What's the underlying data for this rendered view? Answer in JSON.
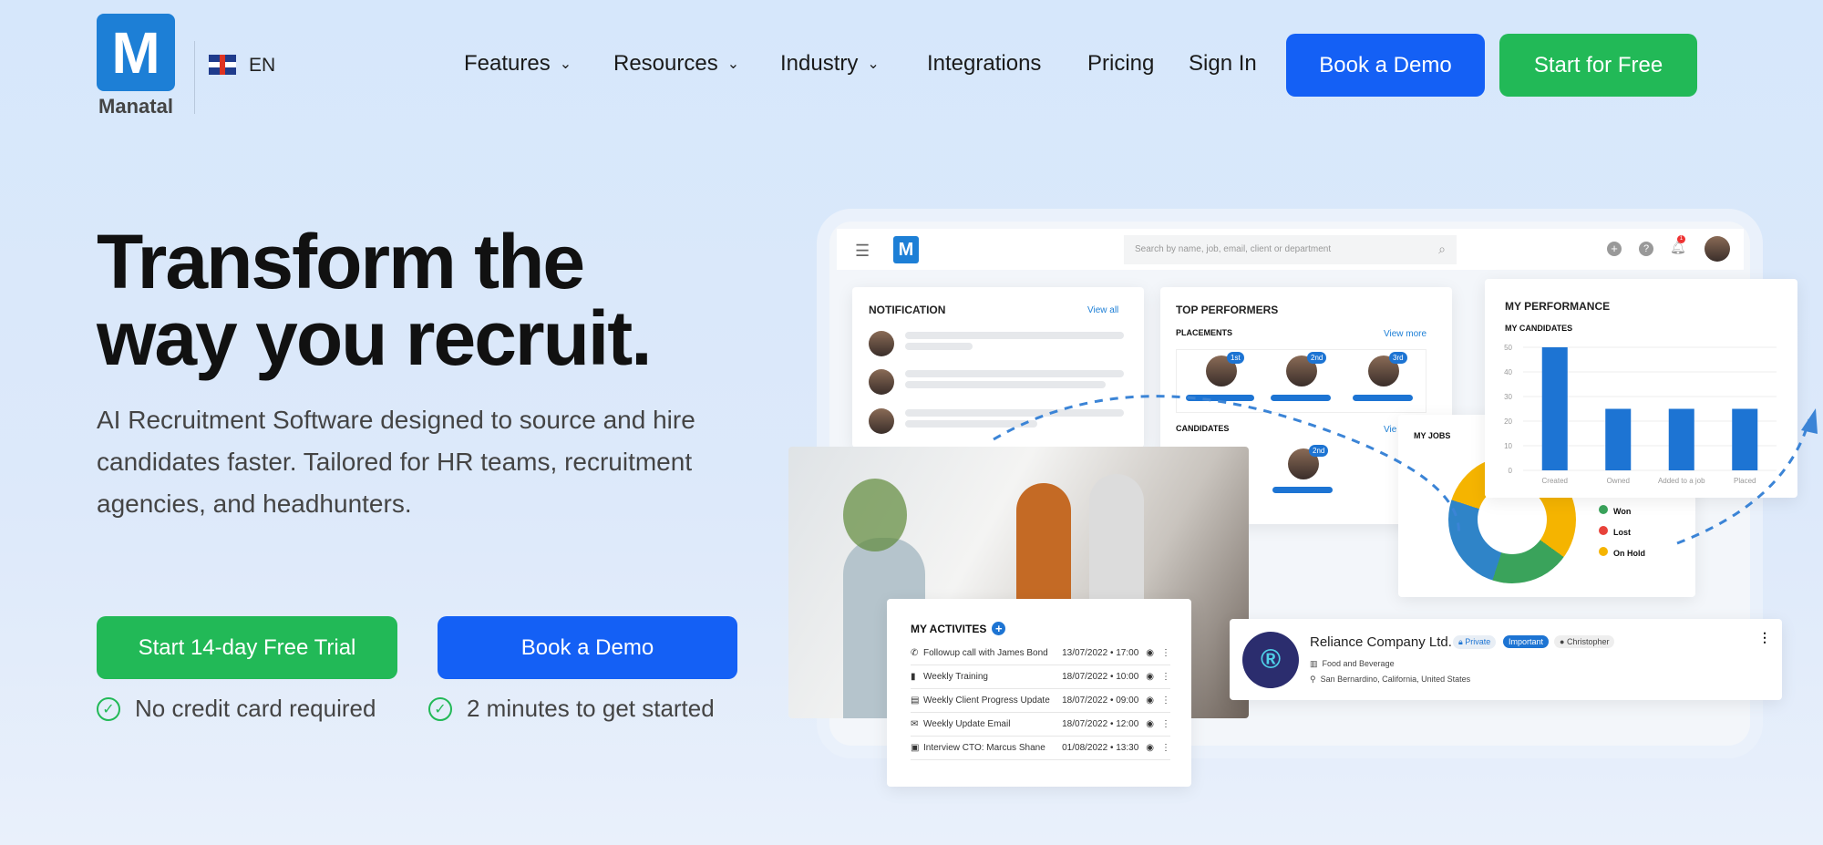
{
  "brand": {
    "name": "Manatal",
    "logo_letter": "M",
    "language": "EN"
  },
  "nav": {
    "items": [
      "Features",
      "Resources",
      "Industry",
      "Integrations",
      "Pricing",
      "Sign In"
    ],
    "book_demo": "Book a Demo",
    "start_free": "Start for Free"
  },
  "hero": {
    "title_line1": "Transform the",
    "title_line2": "way you recruit.",
    "subtitle": "AI Recruitment Software designed to source and hire candidates faster. Tailored for HR teams, recruitment agencies, and headhunters.",
    "cta_trial": "Start 14-day Free Trial",
    "cta_demo": "Book a Demo",
    "check1": "No credit card required",
    "check2": "2 minutes to get started"
  },
  "mock": {
    "search_placeholder": "Search by name, job, email, client or department",
    "notif_count": "1",
    "notification": {
      "title": "NOTIFICATION",
      "link": "View all"
    },
    "top": {
      "title": "TOP PERFORMERS",
      "placements": "PLACEMENTS",
      "view_more": "View more",
      "ranks": [
        "1st",
        "2nd",
        "3rd"
      ],
      "candidates": "CANDIDATES",
      "candidates_link": "Vie",
      "cand_rank": "2nd"
    },
    "performance": {
      "title": "MY PERFORMANCE",
      "subtitle": "MY CANDIDATES"
    },
    "jobs": {
      "title": "MY JOBS",
      "legend": [
        {
          "label": "Won",
          "color": "#3aa35b"
        },
        {
          "label": "Lost",
          "color": "#e8423a"
        },
        {
          "label": "On Hold",
          "color": "#f5b400"
        }
      ]
    },
    "activities": {
      "title": "MY ACTIVITES",
      "items": [
        {
          "icon": "phone-icon",
          "label": "Followup call with James Bond",
          "time": "13/07/2022 • 17:00"
        },
        {
          "icon": "training-icon",
          "label": "Weekly Training",
          "time": "18/07/2022 • 10:00"
        },
        {
          "icon": "clipboard-icon",
          "label": "Weekly Client Progress Update",
          "time": "18/07/2022 • 09:00"
        },
        {
          "icon": "email-icon",
          "label": "Weekly Update Email",
          "time": "18/07/2022 • 12:00"
        },
        {
          "icon": "badge-icon",
          "label": "Interview CTO: Marcus Shane",
          "time": "01/08/2022 • 13:30"
        }
      ]
    },
    "company": {
      "name": "Reliance Company Ltd.",
      "private": "Private",
      "important": "Important",
      "owner": "Christopher",
      "industry": "Food and Beverage",
      "location": "San Bernardino, California, United States"
    }
  },
  "chart_data": {
    "type": "bar",
    "title": "MY CANDIDATES",
    "categories": [
      "Created",
      "Owned",
      "Added to a job",
      "Placed"
    ],
    "values": [
      50,
      25,
      25,
      25
    ],
    "ylim": [
      0,
      50
    ],
    "yticks": [
      0,
      10,
      20,
      30,
      40,
      50
    ],
    "grid": true,
    "color": "#1d74d3"
  }
}
